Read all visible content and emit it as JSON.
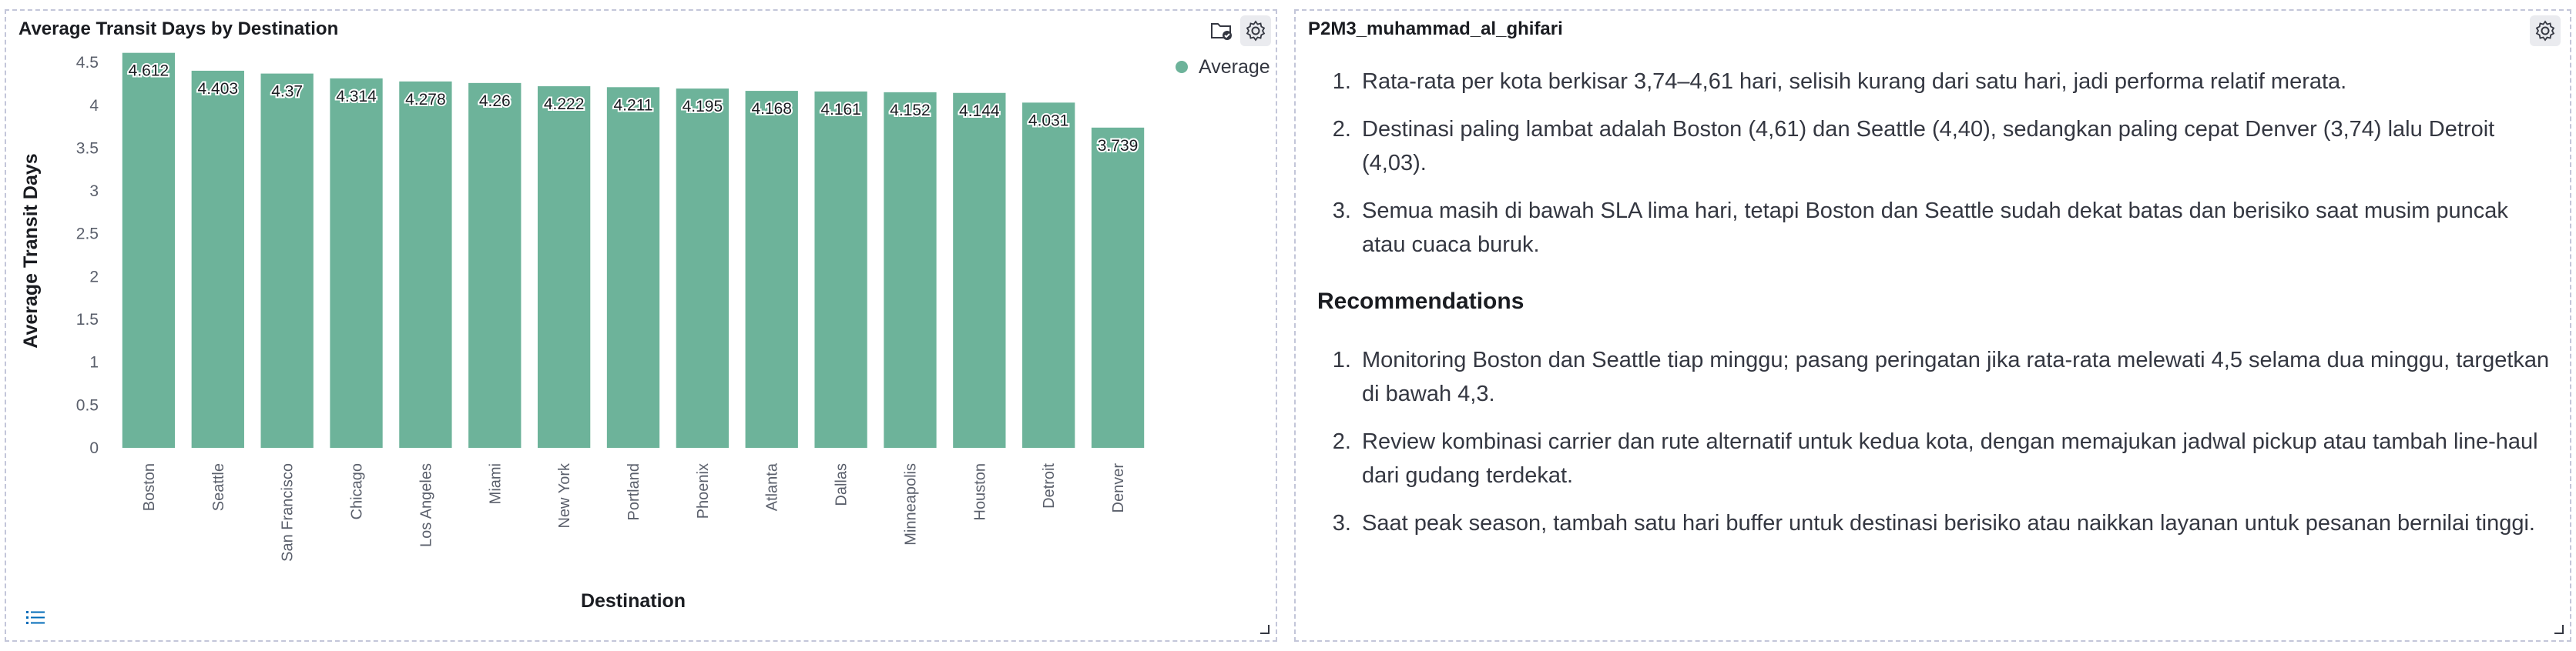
{
  "left_panel": {
    "title": "Average Transit Days by Destination",
    "icons": [
      "folder-check-icon",
      "gear-icon",
      "list-icon",
      "resize-icon"
    ]
  },
  "right_panel": {
    "title": "P2M3_muhammad_al_ghifari",
    "insights": [
      "Rata-rata per kota berkisar 3,74–4,61 hari, selisih kurang dari satu hari, jadi performa relatif merata.",
      "Destinasi paling lambat adalah Boston (4,61) dan Seattle (4,40), sedangkan paling cepat Denver (3,74) lalu Detroit (4,03).",
      "Semua masih di bawah SLA lima hari, tetapi Boston dan Seattle sudah dekat batas dan berisiko saat musim puncak atau cuaca buruk."
    ],
    "recommendations_heading": "Recommendations",
    "recommendations": [
      "Monitoring Boston dan Seattle tiap minggu; pasang peringatan jika rata-rata melewati 4,5 selama dua minggu, targetkan di bawah 4,3.",
      "Review kombinasi carrier dan rute alternatif untuk kedua kota, dengan memajukan jadwal pickup atau tambah line-haul dari gudang terdekat.",
      "Saat peak season, tambah satu hari buffer untuk destinasi berisiko atau naikkan layanan untuk pesanan bernilai tinggi."
    ],
    "icons": [
      "gear-icon",
      "resize-icon"
    ]
  },
  "colors": {
    "bar": "#6db39a",
    "border": "#c3c6d9",
    "gridline": "#eef0f3"
  },
  "chart_data": {
    "type": "bar",
    "title": "Average Transit Days by Destination",
    "xlabel": "Destination",
    "ylabel": "Average Transit Days",
    "categories": [
      "Boston",
      "Seattle",
      "San Francisco",
      "Chicago",
      "Los Angeles",
      "Miami",
      "New York",
      "Portland",
      "Phoenix",
      "Atlanta",
      "Dallas",
      "Minneapolis",
      "Houston",
      "Detroit",
      "Denver"
    ],
    "series": [
      {
        "name": "Average",
        "values": [
          4.612,
          4.403,
          4.37,
          4.314,
          4.278,
          4.26,
          4.222,
          4.211,
          4.195,
          4.168,
          4.161,
          4.152,
          4.144,
          4.031,
          3.739
        ]
      }
    ],
    "value_labels": [
      "4.612",
      "4.403",
      "4.37",
      "4.314",
      "4.278",
      "4.26",
      "4.222",
      "4.211",
      "4.195",
      "4.168",
      "4.161",
      "4.152",
      "4.144",
      "4.031",
      "3.739"
    ],
    "yticks": [
      "0",
      "0.5",
      "1",
      "1.5",
      "2",
      "2.5",
      "3",
      "3.5",
      "4",
      "4.5"
    ],
    "ylim": [
      0,
      4.6
    ],
    "legend": "top-right",
    "grid": false
  }
}
